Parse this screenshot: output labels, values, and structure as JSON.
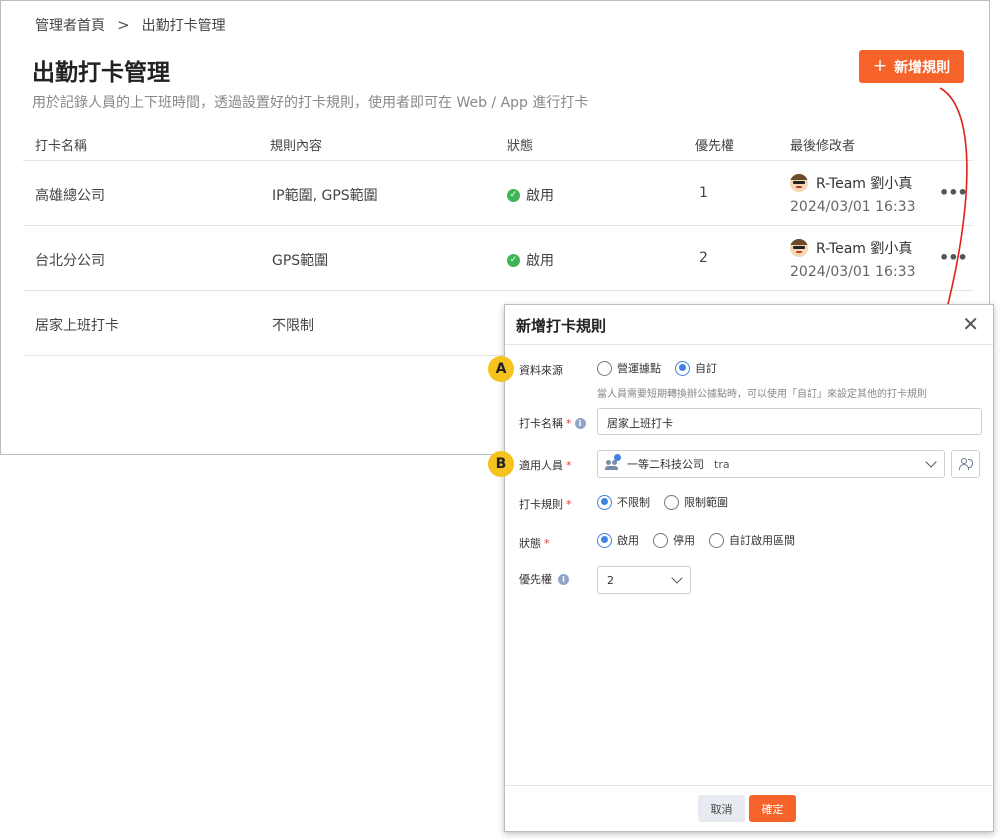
{
  "breadcrumb": {
    "home": "管理者首頁",
    "separator": ">",
    "current": "出勤打卡管理"
  },
  "page": {
    "title": "出勤打卡管理",
    "description": "用於記錄人員的上下班時間，透過設置好的打卡規則，使用者即可在 Web / App 進行打卡",
    "add_button": "新增規則",
    "add_icon": "+"
  },
  "table": {
    "headers": [
      "打卡名稱",
      "規則內容",
      "狀態",
      "優先權",
      "最後修改者"
    ],
    "rows": [
      {
        "name": "高雄總公司",
        "rule": "IP範圍, GPS範圍",
        "status": "啟用",
        "priority": "1",
        "modifier": "R-Team 劉小真",
        "modified_at": "2024/03/01 16:33",
        "more": "•••"
      },
      {
        "name": "台北分公司",
        "rule": "GPS範圍",
        "status": "啟用",
        "priority": "2",
        "modifier": "R-Team 劉小真",
        "modified_at": "2024/03/01 16:33",
        "more": "•••"
      },
      {
        "name": "居家上班打卡",
        "rule": "不限制"
      }
    ]
  },
  "dialog": {
    "title": "新增打卡規則",
    "close": "✕",
    "source": {
      "label": "資料來源",
      "options": [
        "營運據點",
        "自訂"
      ],
      "selected": "自訂",
      "hint": "當人員需要短期轉換辦公據點時，可以使用「自訂」來設定其他的打卡規則"
    },
    "name": {
      "label": "打卡名稱",
      "required": "*",
      "info": "i",
      "value": "居家上班打卡"
    },
    "applicable": {
      "label": "適用人員",
      "required": "*",
      "tag": "一等二科技公司",
      "query": "tra"
    },
    "rule": {
      "label": "打卡規則",
      "required": "*",
      "options": [
        "不限制",
        "限制範圍"
      ],
      "selected": "不限制"
    },
    "status": {
      "label": "狀態",
      "required": "*",
      "options": [
        "啟用",
        "停用",
        "自訂啟用區間"
      ],
      "selected": "啟用"
    },
    "priority": {
      "label": "優先權",
      "info": "i",
      "value": "2"
    },
    "cancel": "取消",
    "confirm": "確定"
  },
  "markers": {
    "a": "A",
    "b": "B"
  },
  "colors": {
    "accent": "#f5622a",
    "radio": "#3f82e0",
    "enabled": "#3fb557",
    "marker": "#f6c21e",
    "arrow": "#e0201c"
  }
}
